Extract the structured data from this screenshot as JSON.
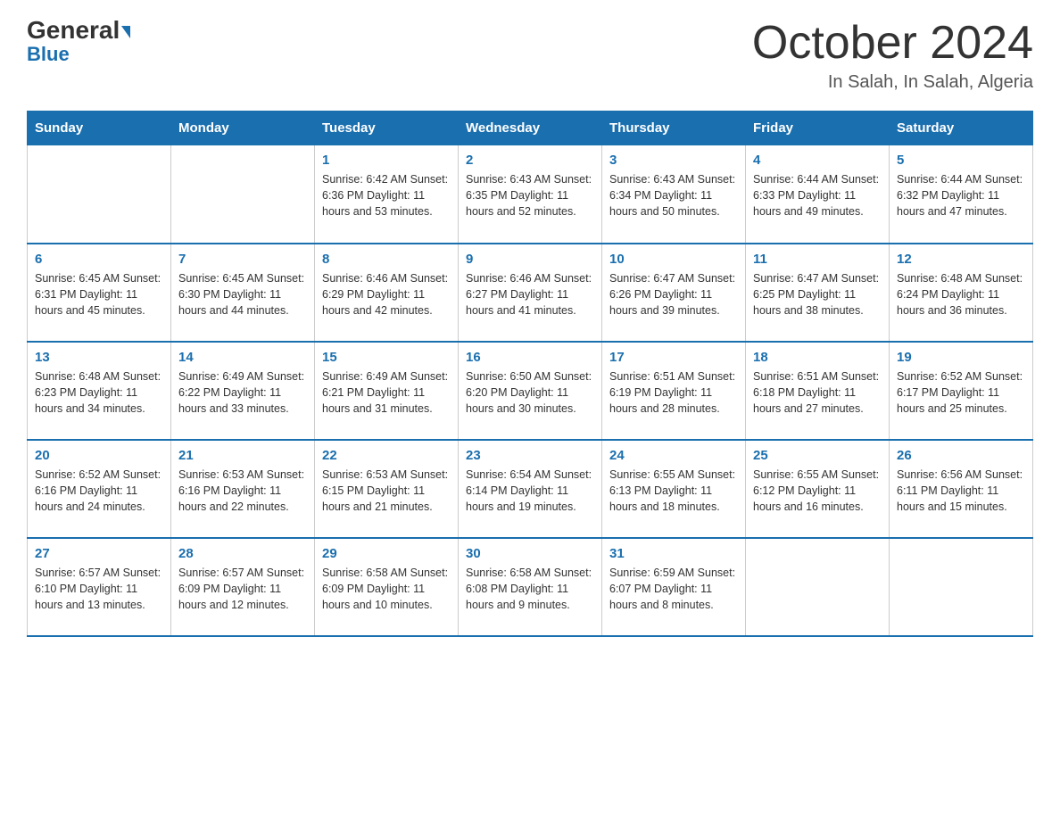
{
  "header": {
    "logo_general": "General",
    "logo_blue": "Blue",
    "month_title": "October 2024",
    "location": "In Salah, In Salah, Algeria"
  },
  "days_of_week": [
    "Sunday",
    "Monday",
    "Tuesday",
    "Wednesday",
    "Thursday",
    "Friday",
    "Saturday"
  ],
  "weeks": [
    [
      {
        "day": "",
        "info": ""
      },
      {
        "day": "",
        "info": ""
      },
      {
        "day": "1",
        "info": "Sunrise: 6:42 AM\nSunset: 6:36 PM\nDaylight: 11 hours\nand 53 minutes."
      },
      {
        "day": "2",
        "info": "Sunrise: 6:43 AM\nSunset: 6:35 PM\nDaylight: 11 hours\nand 52 minutes."
      },
      {
        "day": "3",
        "info": "Sunrise: 6:43 AM\nSunset: 6:34 PM\nDaylight: 11 hours\nand 50 minutes."
      },
      {
        "day": "4",
        "info": "Sunrise: 6:44 AM\nSunset: 6:33 PM\nDaylight: 11 hours\nand 49 minutes."
      },
      {
        "day": "5",
        "info": "Sunrise: 6:44 AM\nSunset: 6:32 PM\nDaylight: 11 hours\nand 47 minutes."
      }
    ],
    [
      {
        "day": "6",
        "info": "Sunrise: 6:45 AM\nSunset: 6:31 PM\nDaylight: 11 hours\nand 45 minutes."
      },
      {
        "day": "7",
        "info": "Sunrise: 6:45 AM\nSunset: 6:30 PM\nDaylight: 11 hours\nand 44 minutes."
      },
      {
        "day": "8",
        "info": "Sunrise: 6:46 AM\nSunset: 6:29 PM\nDaylight: 11 hours\nand 42 minutes."
      },
      {
        "day": "9",
        "info": "Sunrise: 6:46 AM\nSunset: 6:27 PM\nDaylight: 11 hours\nand 41 minutes."
      },
      {
        "day": "10",
        "info": "Sunrise: 6:47 AM\nSunset: 6:26 PM\nDaylight: 11 hours\nand 39 minutes."
      },
      {
        "day": "11",
        "info": "Sunrise: 6:47 AM\nSunset: 6:25 PM\nDaylight: 11 hours\nand 38 minutes."
      },
      {
        "day": "12",
        "info": "Sunrise: 6:48 AM\nSunset: 6:24 PM\nDaylight: 11 hours\nand 36 minutes."
      }
    ],
    [
      {
        "day": "13",
        "info": "Sunrise: 6:48 AM\nSunset: 6:23 PM\nDaylight: 11 hours\nand 34 minutes."
      },
      {
        "day": "14",
        "info": "Sunrise: 6:49 AM\nSunset: 6:22 PM\nDaylight: 11 hours\nand 33 minutes."
      },
      {
        "day": "15",
        "info": "Sunrise: 6:49 AM\nSunset: 6:21 PM\nDaylight: 11 hours\nand 31 minutes."
      },
      {
        "day": "16",
        "info": "Sunrise: 6:50 AM\nSunset: 6:20 PM\nDaylight: 11 hours\nand 30 minutes."
      },
      {
        "day": "17",
        "info": "Sunrise: 6:51 AM\nSunset: 6:19 PM\nDaylight: 11 hours\nand 28 minutes."
      },
      {
        "day": "18",
        "info": "Sunrise: 6:51 AM\nSunset: 6:18 PM\nDaylight: 11 hours\nand 27 minutes."
      },
      {
        "day": "19",
        "info": "Sunrise: 6:52 AM\nSunset: 6:17 PM\nDaylight: 11 hours\nand 25 minutes."
      }
    ],
    [
      {
        "day": "20",
        "info": "Sunrise: 6:52 AM\nSunset: 6:16 PM\nDaylight: 11 hours\nand 24 minutes."
      },
      {
        "day": "21",
        "info": "Sunrise: 6:53 AM\nSunset: 6:16 PM\nDaylight: 11 hours\nand 22 minutes."
      },
      {
        "day": "22",
        "info": "Sunrise: 6:53 AM\nSunset: 6:15 PM\nDaylight: 11 hours\nand 21 minutes."
      },
      {
        "day": "23",
        "info": "Sunrise: 6:54 AM\nSunset: 6:14 PM\nDaylight: 11 hours\nand 19 minutes."
      },
      {
        "day": "24",
        "info": "Sunrise: 6:55 AM\nSunset: 6:13 PM\nDaylight: 11 hours\nand 18 minutes."
      },
      {
        "day": "25",
        "info": "Sunrise: 6:55 AM\nSunset: 6:12 PM\nDaylight: 11 hours\nand 16 minutes."
      },
      {
        "day": "26",
        "info": "Sunrise: 6:56 AM\nSunset: 6:11 PM\nDaylight: 11 hours\nand 15 minutes."
      }
    ],
    [
      {
        "day": "27",
        "info": "Sunrise: 6:57 AM\nSunset: 6:10 PM\nDaylight: 11 hours\nand 13 minutes."
      },
      {
        "day": "28",
        "info": "Sunrise: 6:57 AM\nSunset: 6:09 PM\nDaylight: 11 hours\nand 12 minutes."
      },
      {
        "day": "29",
        "info": "Sunrise: 6:58 AM\nSunset: 6:09 PM\nDaylight: 11 hours\nand 10 minutes."
      },
      {
        "day": "30",
        "info": "Sunrise: 6:58 AM\nSunset: 6:08 PM\nDaylight: 11 hours\nand 9 minutes."
      },
      {
        "day": "31",
        "info": "Sunrise: 6:59 AM\nSunset: 6:07 PM\nDaylight: 11 hours\nand 8 minutes."
      },
      {
        "day": "",
        "info": ""
      },
      {
        "day": "",
        "info": ""
      }
    ]
  ]
}
